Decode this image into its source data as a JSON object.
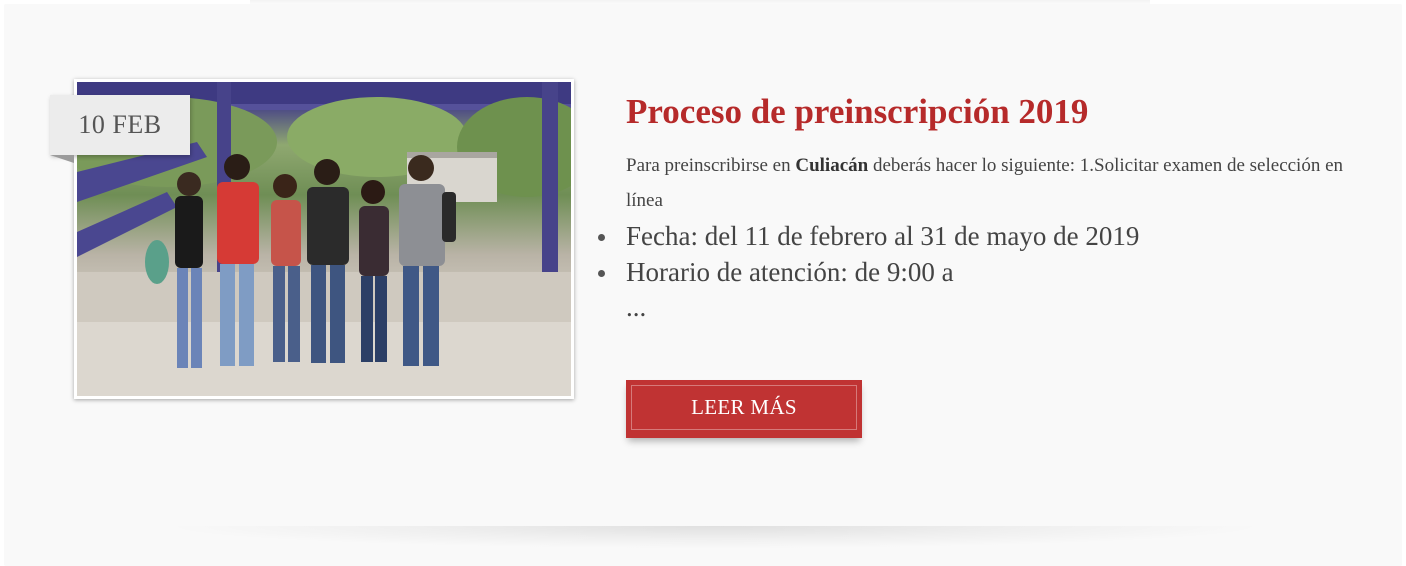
{
  "post": {
    "date": "10 FEB",
    "title": "Proceso de preinscripción 2019",
    "intro": {
      "prefix": "Para preinscribirse en ",
      "bold": "Culiacán",
      "suffix": " deberás hacer lo siguiente: 1.Solicitar examen de selección en línea"
    },
    "bullets": [
      "Fecha: del 11 de febrero al 31 de mayo de 2019",
      "Horario de atención: de 9:00 a"
    ],
    "ellipsis": "...",
    "read_more_label": "LEER MÁS"
  },
  "colors": {
    "title": "#b62a2a",
    "button": "#c03333",
    "card_background": "#f9f9f9",
    "badge_background": "#ececec"
  },
  "icons": {
    "bullet": "bullet-dot-icon"
  }
}
